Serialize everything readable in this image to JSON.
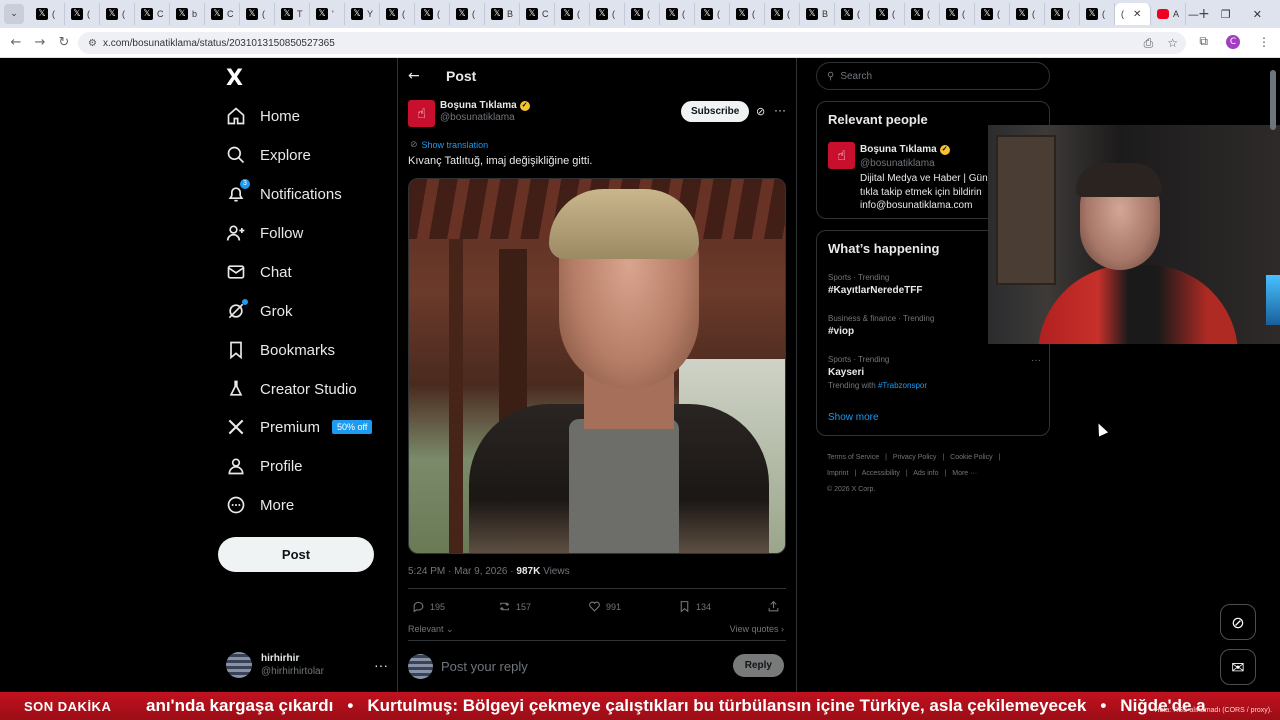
{
  "browser": {
    "url": "x.com/bosunatiklama/status/2031013150850527365",
    "tabs": [
      "(",
      "(",
      "(",
      "C",
      "b",
      "C",
      "(",
      "T",
      "'",
      "Y",
      "(",
      "(",
      "(",
      "B",
      "C",
      "(",
      "(",
      "(",
      "(",
      "(",
      "(",
      "(",
      "B",
      "(",
      "(",
      "(",
      "(",
      "(",
      "(",
      "(",
      "(",
      "A"
    ],
    "active_tab_title": "(",
    "new_tab": "+",
    "profile_initial": "C"
  },
  "nav": {
    "logo": "X",
    "items": [
      {
        "label": "Home",
        "icon": "home-icon"
      },
      {
        "label": "Explore",
        "icon": "search-icon"
      },
      {
        "label": "Notifications",
        "icon": "bell-icon",
        "badge": "3"
      },
      {
        "label": "Follow",
        "icon": "add-person-icon"
      },
      {
        "label": "Chat",
        "icon": "mail-icon"
      },
      {
        "label": "Grok",
        "icon": "grok-icon"
      },
      {
        "label": "Bookmarks",
        "icon": "bookmark-icon"
      },
      {
        "label": "Creator Studio",
        "icon": "flask-icon"
      },
      {
        "label": "Premium",
        "icon": "x-icon",
        "promo": "50% off"
      },
      {
        "label": "Profile",
        "icon": "person-icon"
      },
      {
        "label": "More",
        "icon": "more-circle-icon"
      }
    ],
    "post_button": "Post",
    "account": {
      "name": "hirhirhir",
      "handle": "@hirhirhirtolar"
    }
  },
  "post": {
    "header_title": "Post",
    "author_name": "Boşuna Tıklama",
    "author_handle": "@bosunatiklama",
    "subscribe": "Subscribe",
    "show_translation": "Show translation",
    "text": "Kıvanç Tatlıtuğ, imaj değişikliğine gitti.",
    "time": "5:24 PM · Mar 9, 2026 · ",
    "views_count": "987K",
    "views_label": " Views",
    "replies": "195",
    "reposts": "157",
    "likes": "991",
    "bookmarks": "134",
    "sort": "Relevant",
    "view_quotes": "View quotes",
    "reply_placeholder": "Post your reply",
    "reply_button": "Reply"
  },
  "sidebar": {
    "search_placeholder": "Search",
    "relevant_title": "Relevant people",
    "person": {
      "name": "Boşuna Tıklama",
      "handle": "@bosunatiklama",
      "bio_1": "Dijital Medya ve Haber | Gün",
      "bio_2": "tıkla takip etmek için bildirin",
      "bio_3": "info@bosunatiklama.com"
    },
    "happening_title": "What’s happening",
    "trends": [
      {
        "category": "Sports · Trending",
        "title": "#KayıtlarNeredeTFF"
      },
      {
        "category": "Business & finance · Trending",
        "title": "#viop"
      },
      {
        "category": "Sports · Trending",
        "title": "Kayseri",
        "with_label": "Trending with ",
        "with_tag": "#Trabzonspor"
      }
    ],
    "show_more": "Show more",
    "footer": [
      "Terms of Service",
      "|",
      "Privacy Policy",
      "|",
      "Cookie Policy",
      "|",
      "Imprint",
      "|",
      "Accessibility",
      "|",
      "Ads info",
      "|",
      "More ···"
    ],
    "copyright": "© 2026 X Corp."
  },
  "ticker": {
    "label": "SON DAKİKA",
    "item1": "anı'nda kargaşa çıkardı",
    "item2": "Kurtulmuş: Bölgeyi çekmeye çalıştıkları bu türbülansın içine Türkiye, asla çekilemeyecek",
    "item3": "Niğde'de a",
    "bullet": "•",
    "rss_error": "Hata: RSS alınamadı (CORS / proxy)."
  }
}
